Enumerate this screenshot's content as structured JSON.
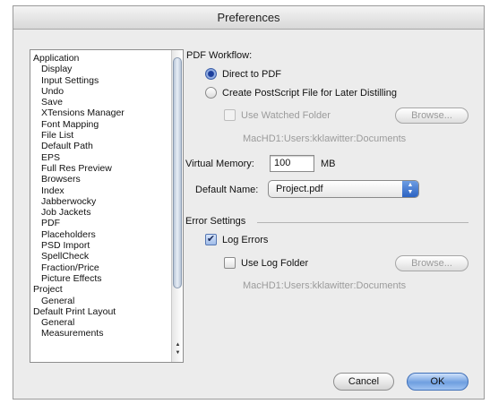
{
  "window": {
    "title": "Preferences"
  },
  "sidebar": {
    "items": [
      {
        "label": "Application",
        "level": 0
      },
      {
        "label": "Display",
        "level": 1
      },
      {
        "label": "Input Settings",
        "level": 1
      },
      {
        "label": "Undo",
        "level": 1
      },
      {
        "label": "Save",
        "level": 1
      },
      {
        "label": "XTensions Manager",
        "level": 1
      },
      {
        "label": "Font Mapping",
        "level": 1
      },
      {
        "label": "File List",
        "level": 1
      },
      {
        "label": "Default Path",
        "level": 1
      },
      {
        "label": "EPS",
        "level": 1
      },
      {
        "label": "Full Res Preview",
        "level": 1
      },
      {
        "label": "Browsers",
        "level": 1
      },
      {
        "label": "Index",
        "level": 1
      },
      {
        "label": "Jabberwocky",
        "level": 1
      },
      {
        "label": "Job Jackets",
        "level": 1
      },
      {
        "label": "PDF",
        "level": 1,
        "selected": true
      },
      {
        "label": "Placeholders",
        "level": 1
      },
      {
        "label": "PSD Import",
        "level": 1
      },
      {
        "label": "SpellCheck",
        "level": 1
      },
      {
        "label": "Fraction/Price",
        "level": 1
      },
      {
        "label": "Picture Effects",
        "level": 1
      },
      {
        "label": "Project",
        "level": 0
      },
      {
        "label": "General",
        "level": 1
      },
      {
        "label": "Default Print Layout",
        "level": 0
      },
      {
        "label": "General",
        "level": 1
      },
      {
        "label": "Measurements",
        "level": 1
      }
    ]
  },
  "pdf_workflow": {
    "label": "PDF Workflow:",
    "direct_label": "Direct to PDF",
    "direct_selected": true,
    "postscript_label": "Create PostScript File for Later Distilling",
    "postscript_selected": false,
    "watched_folder_label": "Use Watched Folder",
    "watched_folder_checked": false,
    "browse_label": "Browse...",
    "watched_path": "MacHD1:Users:kklawitter:Documents"
  },
  "virtual_memory": {
    "label": "Virtual Memory:",
    "value": "100",
    "unit": "MB"
  },
  "default_name": {
    "label": "Default Name:",
    "value": "Project.pdf"
  },
  "error_settings": {
    "label": "Error Settings",
    "log_errors_label": "Log Errors",
    "log_errors_checked": true,
    "log_folder_label": "Use Log Folder",
    "log_folder_checked": false,
    "browse_label": "Browse...",
    "log_path": "MacHD1:Users:kklawitter:Documents"
  },
  "footer": {
    "cancel_label": "Cancel",
    "ok_label": "OK"
  },
  "colors": {
    "accent": "#2d63c2",
    "window_bg": "#ececec",
    "disabled_text": "#9b9b9b"
  }
}
